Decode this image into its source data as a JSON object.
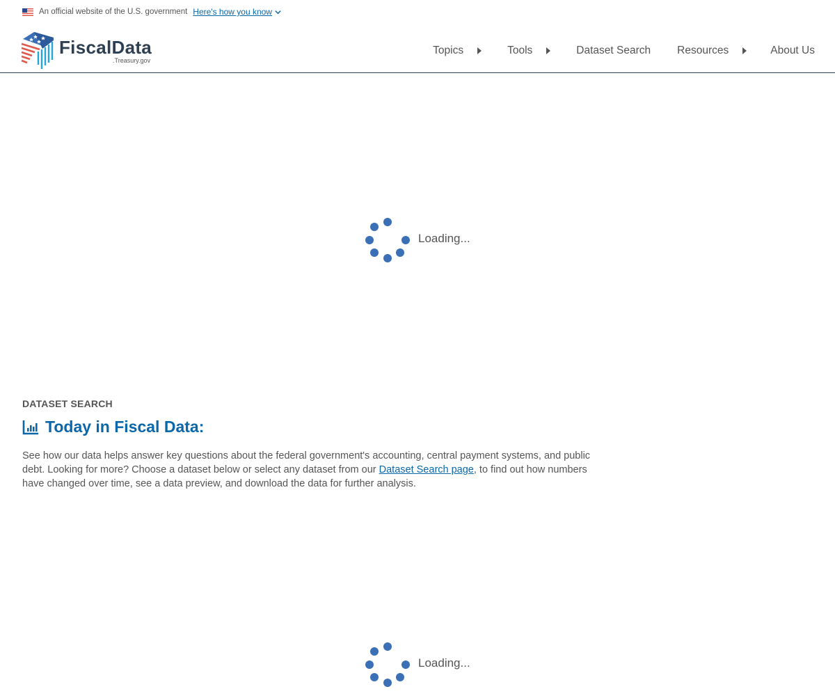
{
  "gov_banner": {
    "text": "An official website of the U.S. government",
    "link": "Here's how you know"
  },
  "logo": {
    "title": "FiscalData",
    "subtitle": ".Treasury.gov"
  },
  "nav": {
    "items": [
      {
        "label": "Topics",
        "has_submenu": true
      },
      {
        "label": "Tools",
        "has_submenu": true
      },
      {
        "label": "Dataset Search",
        "has_submenu": false
      },
      {
        "label": "Resources",
        "has_submenu": true
      },
      {
        "label": "About Us",
        "has_submenu": false
      }
    ]
  },
  "loaders": {
    "top": "Loading...",
    "bottom": "Loading..."
  },
  "section": {
    "eyebrow": "DATASET SEARCH",
    "title": "Today in Fiscal Data:",
    "desc_before": "See how our data helps answer key questions about the federal government's accounting, central payment systems, and public debt. Looking for more? Choose a dataset below or select any dataset from our ",
    "desc_link": "Dataset Search page",
    "desc_after": ", to find out how numbers have changed over time, see a data preview, and download the data for further analysis."
  },
  "colors": {
    "brand_navy": "#2d3f52",
    "link_blue": "#0a67a9",
    "spinner_blue": "#3b6fb6",
    "flag_red": "#e0584b"
  }
}
